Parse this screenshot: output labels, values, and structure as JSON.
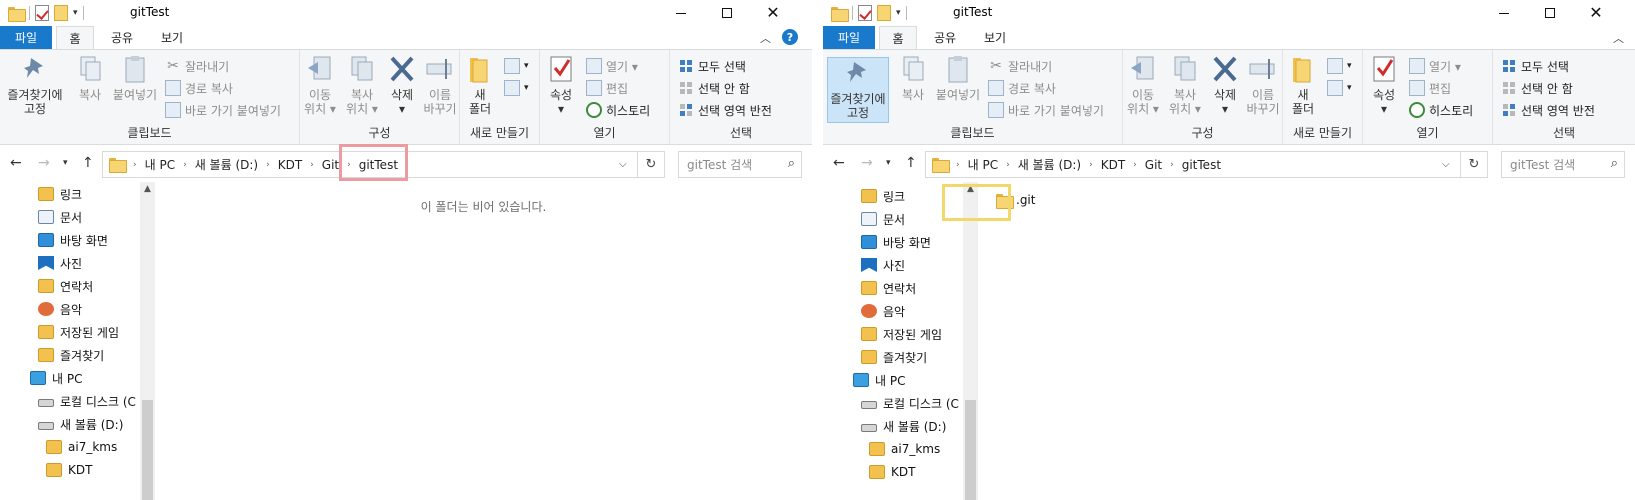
{
  "left_window": {
    "title": "gitTest",
    "tabs": {
      "file": "파일",
      "home": "홈",
      "share": "공유",
      "view": "보기"
    },
    "ribbon": {
      "clipboard": {
        "label": "클립보드",
        "pin": "즐겨찾기에\n고정",
        "copy": "복사",
        "paste": "붙여넣기",
        "cut": "잘라내기",
        "copy_path": "경로 복사",
        "paste_shortcut": "바로 가기 붙여넣기"
      },
      "organize": {
        "label": "구성",
        "move_to": "이동\n위치 ▾",
        "copy_to": "복사\n위치 ▾",
        "delete": "삭제\n▾",
        "rename": "이름\n바꾸기"
      },
      "new": {
        "label": "새로 만들기",
        "new_folder": "새\n폴더"
      },
      "open": {
        "label": "열기",
        "properties": "속성\n▾",
        "open": "열기 ▾",
        "edit": "편집",
        "history": "히스토리"
      },
      "select": {
        "label": "선택",
        "select_all": "모두 선택",
        "select_none": "선택 안 함",
        "invert": "선택 영역 반전"
      }
    },
    "address": {
      "crumbs": [
        "내 PC",
        "새 볼륨 (D:)",
        "KDT",
        "Git",
        "gitTest"
      ]
    },
    "search_placeholder": "gitTest 검색",
    "nav_items": [
      "링크",
      "문서",
      "바탕 화면",
      "사진",
      "연락처",
      "음악",
      "저장된 게임",
      "즐겨찾기",
      "내 PC",
      "로컬 디스크 (C",
      "새 볼륨 (D:)",
      "ai7_kms",
      "KDT"
    ],
    "empty_message": "이 폴더는 비어 있습니다."
  },
  "right_window": {
    "title": "gitTest",
    "tabs": {
      "file": "파일",
      "home": "홈",
      "share": "공유",
      "view": "보기"
    },
    "ribbon": {
      "clipboard": {
        "label": "클립보드",
        "pin": "즐겨찾기에\n고정",
        "copy": "복사",
        "paste": "붙여넣기",
        "cut": "잘라내기",
        "copy_path": "경로 복사",
        "paste_shortcut": "바로 가기 붙여넣기"
      },
      "organize": {
        "label": "구성",
        "move_to": "이동\n위치 ▾",
        "copy_to": "복사\n위치 ▾",
        "delete": "삭제\n▾",
        "rename": "이름\n바꾸기"
      },
      "new": {
        "label": "새로 만들기",
        "new_folder": "새\n폴더"
      },
      "open": {
        "label": "열기",
        "properties": "속성\n▾",
        "open": "열기 ▾",
        "edit": "편집",
        "history": "히스토리"
      },
      "select": {
        "label": "선택",
        "select_all": "모두 선택",
        "select_none": "선택 안 함",
        "invert": "선택 영역 반전"
      }
    },
    "address": {
      "crumbs": [
        "내 PC",
        "새 볼륨 (D:)",
        "KDT",
        "Git",
        "gitTest"
      ]
    },
    "search_placeholder": "gitTest 검색",
    "nav_items": [
      "링크",
      "문서",
      "바탕 화면",
      "사진",
      "연락처",
      "음악",
      "저장된 게임",
      "즐겨찾기",
      "내 PC",
      "로컬 디스크 (C",
      "새 볼륨 (D:)",
      "ai7_kms",
      "KDT"
    ],
    "files": [
      ".git"
    ]
  },
  "colors": {
    "accent": "#1979ca",
    "highlight_red": "#ec9ba0",
    "highlight_yellow": "#f2d86b",
    "folder": "#f7d573"
  }
}
